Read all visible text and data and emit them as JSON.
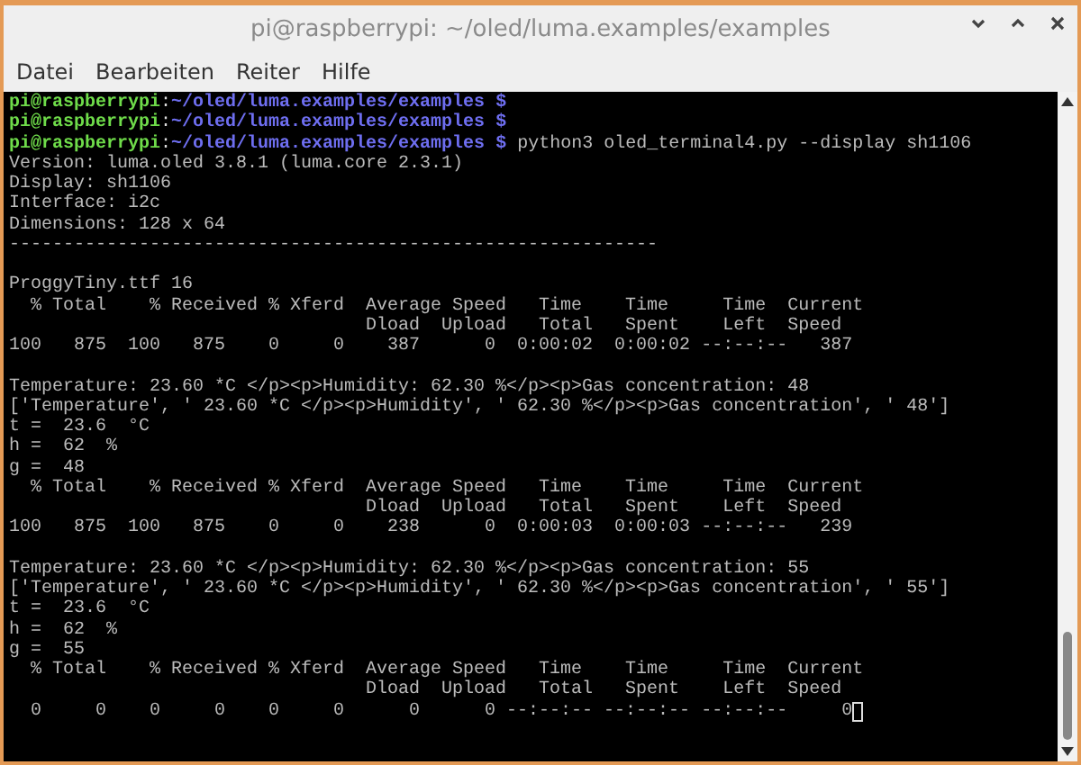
{
  "window": {
    "title": "pi@raspberrypi: ~/oled/luma.examples/examples"
  },
  "menu": [
    "Datei",
    "Bearbeiten",
    "Reiter",
    "Hilfe"
  ],
  "terminal": {
    "lines": [
      {
        "kind": "prompt",
        "user": "pi@raspberrypi",
        "sep": ":",
        "path": "~/oled/luma.examples/examples",
        "symbol": "$"
      },
      {
        "kind": "prompt",
        "user": "pi@raspberrypi",
        "sep": ":",
        "path": "~/oled/luma.examples/examples",
        "symbol": "$"
      },
      {
        "kind": "prompt",
        "user": "pi@raspberrypi",
        "sep": ":",
        "path": "~/oled/luma.examples/examples",
        "symbol": "$",
        "command": "python3 oled_terminal4.py --display sh1106"
      },
      {
        "kind": "output",
        "text": "Version: luma.oled 3.8.1 (luma.core 2.3.1)"
      },
      {
        "kind": "output",
        "text": "Display: sh1106"
      },
      {
        "kind": "output",
        "text": "Interface: i2c"
      },
      {
        "kind": "output",
        "text": "Dimensions: 128 x 64"
      },
      {
        "kind": "output",
        "text": "------------------------------------------------------------"
      },
      {
        "kind": "blank"
      },
      {
        "kind": "output",
        "text": "ProggyTiny.ttf 16"
      },
      {
        "kind": "output",
        "text": "  % Total    % Received % Xferd  Average Speed   Time    Time     Time  Current"
      },
      {
        "kind": "output",
        "text": "                                 Dload  Upload   Total   Spent    Left  Speed"
      },
      {
        "kind": "output",
        "text": "100   875  100   875    0     0    387      0  0:00:02  0:00:02 --:--:--   387"
      },
      {
        "kind": "blank"
      },
      {
        "kind": "output",
        "text": "Temperature: 23.60 *C </p><p>Humidity: 62.30 %</p><p>Gas concentration: 48"
      },
      {
        "kind": "output",
        "text": "['Temperature', ' 23.60 *C </p><p>Humidity', ' 62.30 %</p><p>Gas concentration', ' 48']"
      },
      {
        "kind": "output",
        "text": "t =  23.6  °C"
      },
      {
        "kind": "output",
        "text": "h =  62  %"
      },
      {
        "kind": "output",
        "text": "g =  48"
      },
      {
        "kind": "output",
        "text": "  % Total    % Received % Xferd  Average Speed   Time    Time     Time  Current"
      },
      {
        "kind": "output",
        "text": "                                 Dload  Upload   Total   Spent    Left  Speed"
      },
      {
        "kind": "output",
        "text": "100   875  100   875    0     0    238      0  0:00:03  0:00:03 --:--:--   239"
      },
      {
        "kind": "blank"
      },
      {
        "kind": "output",
        "text": "Temperature: 23.60 *C </p><p>Humidity: 62.30 %</p><p>Gas concentration: 55"
      },
      {
        "kind": "output",
        "text": "['Temperature', ' 23.60 *C </p><p>Humidity', ' 62.30 %</p><p>Gas concentration', ' 55']"
      },
      {
        "kind": "output",
        "text": "t =  23.6  °C"
      },
      {
        "kind": "output",
        "text": "h =  62  %"
      },
      {
        "kind": "output",
        "text": "g =  55"
      },
      {
        "kind": "output",
        "text": "  % Total    % Received % Xferd  Average Speed   Time    Time     Time  Current"
      },
      {
        "kind": "output",
        "text": "                                 Dload  Upload   Total   Spent    Left  Speed"
      },
      {
        "kind": "output",
        "text": "  0     0    0     0    0     0      0      0 --:--:-- --:--:-- --:--:--     0",
        "cursor": true
      }
    ]
  }
}
